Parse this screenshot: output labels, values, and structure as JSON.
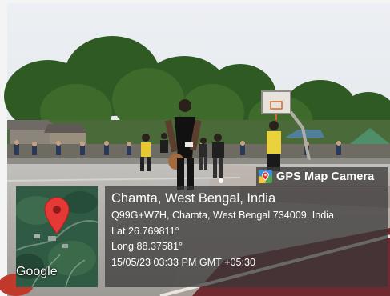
{
  "badge": {
    "label": "GPS Map Camera",
    "icon": "map-pin-camera-icon"
  },
  "map": {
    "provider_label": "Google",
    "marker_icon": "map-marker-icon",
    "marker_color": "#e53935"
  },
  "location": {
    "title": "Chamta, West Bengal, India",
    "address": "Q99G+W7H, Chamta, West Bengal 734009, India",
    "latitude": "Lat 26.769811°",
    "longitude": "Long 88.37581°",
    "timestamp": "15/05/23 03:33 PM GMT +05:30"
  },
  "colors": {
    "panel_bg": "#3a3a3a",
    "text": "#ffffff"
  }
}
